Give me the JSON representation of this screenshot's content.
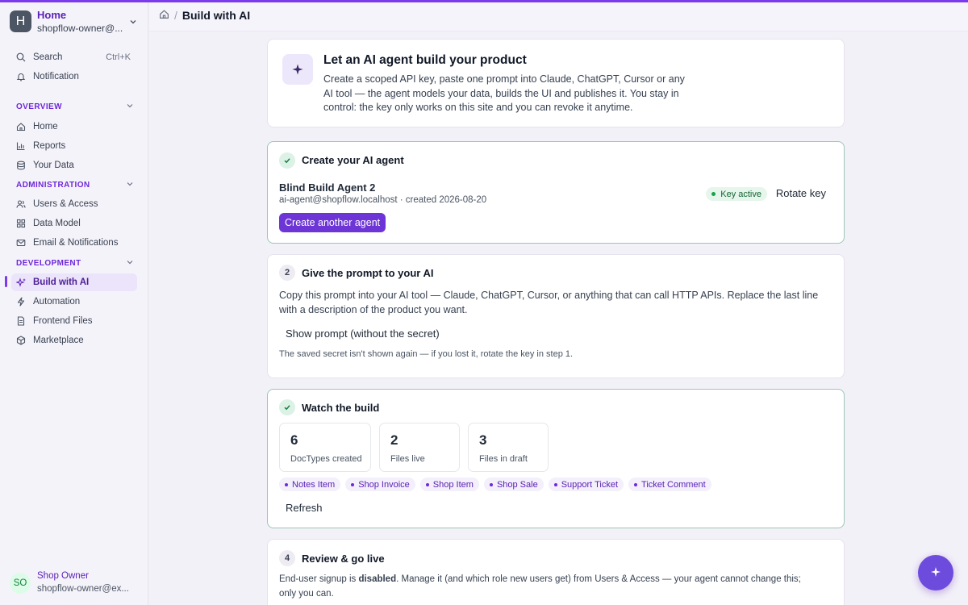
{
  "workspace": {
    "avatar": "H",
    "title": "Home",
    "subtitle": "shopflow-owner@..."
  },
  "sidebar": {
    "search_label": "Search",
    "search_shortcut": "Ctrl+K",
    "notification_label": "Notification",
    "sections": [
      {
        "label": "OVERVIEW",
        "items": [
          {
            "label": "Home"
          },
          {
            "label": "Reports"
          },
          {
            "label": "Your Data"
          }
        ]
      },
      {
        "label": "ADMINISTRATION",
        "items": [
          {
            "label": "Users & Access"
          },
          {
            "label": "Data Model"
          },
          {
            "label": "Email & Notifications"
          }
        ]
      },
      {
        "label": "DEVELOPMENT",
        "items": [
          {
            "label": "Build with AI"
          },
          {
            "label": "Automation"
          },
          {
            "label": "Frontend Files"
          },
          {
            "label": "Marketplace"
          }
        ]
      }
    ],
    "active_item": "Build with AI"
  },
  "user": {
    "initials": "SO",
    "name": "Shop Owner",
    "email": "shopflow-owner@ex..."
  },
  "header": {
    "separator": "/",
    "title": "Build with AI"
  },
  "intro": {
    "icon": "sparkle-icon",
    "title": "Let an AI agent build your product",
    "body": "Create a scoped API key, paste one prompt into Claude, ChatGPT, Cursor or any AI tool — the agent models your data, builds the UI and publishes it. You stay in control: the key only works on this site and you can revoke it anytime."
  },
  "step1": {
    "title": "Create your AI agent",
    "agent_name": "Blind Build Agent 2",
    "agent_meta": "ai-agent@shopflow.localhost · created 2026-08-20",
    "button": "Create another agent",
    "key_status": "Key active",
    "rotate": "Rotate key"
  },
  "step2": {
    "number": "2",
    "title": "Give the prompt to your AI",
    "body": "Copy this prompt into your AI tool — Claude, ChatGPT, Cursor, or anything that can call HTTP APIs. Replace the last line with a description of the product you want.",
    "show_prompt": "Show prompt (without the secret)",
    "note": "The saved secret isn't shown again — if you lost it, rotate the key in step 1."
  },
  "step3": {
    "title": "Watch the build",
    "stats": [
      {
        "value": "6",
        "label": "DocTypes created"
      },
      {
        "value": "2",
        "label": "Files live"
      },
      {
        "value": "3",
        "label": "Files in draft"
      }
    ],
    "chips": [
      "Notes Item",
      "Shop Invoice",
      "Shop Item",
      "Shop Sale",
      "Support Ticket",
      "Ticket Comment"
    ],
    "refresh": "Refresh"
  },
  "step4": {
    "number": "4",
    "title": "Review & go live",
    "body_before": "End-user signup is ",
    "body_bold": "disabled",
    "body_after": ". Manage it (and which role new users get) from Users & Access — your agent cannot change this; only you can."
  },
  "colors": {
    "accent": "#6d35d6",
    "success": "#16a34a",
    "brand_text": "#5b21b6"
  }
}
